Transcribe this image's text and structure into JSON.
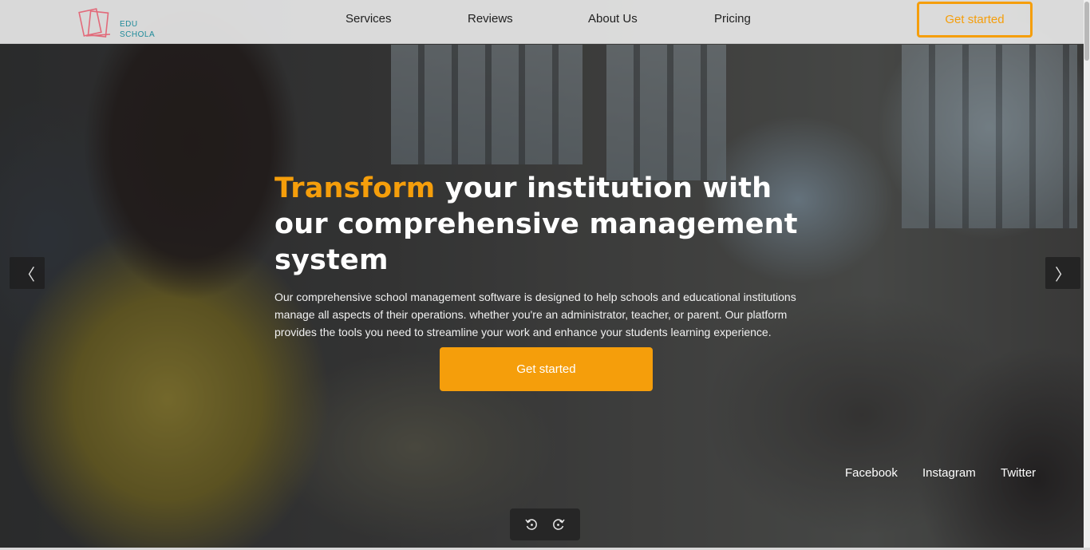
{
  "logo": {
    "line1": "EDU",
    "line2": "SCHOLA"
  },
  "nav": {
    "items": [
      {
        "label": "Services"
      },
      {
        "label": "Reviews"
      },
      {
        "label": "About Us"
      },
      {
        "label": "Pricing"
      }
    ],
    "cta_label": "Get started"
  },
  "hero": {
    "title_accent": "Transform",
    "title_rest": " your institution with our comprehensive management system",
    "description": "Our comprehensive school management software is designed to help schools and educational institutions manage all aspects of their operations. whether you're an administrator, teacher, or parent. Our platform provides the tools you need to streamline your work and enhance your students learning experience.",
    "cta_label": "Get started"
  },
  "carousel": {
    "prev_icon": "chevron-left-icon",
    "next_icon": "chevron-right-icon",
    "prev_glyph": "〈",
    "next_glyph": "〉"
  },
  "social": [
    {
      "label": "Facebook"
    },
    {
      "label": "Instagram"
    },
    {
      "label": "Twitter"
    }
  ],
  "controls": {
    "back_icon": "rewind-icon",
    "forward_icon": "forward-icon"
  },
  "colors": {
    "accent": "#f59e0b",
    "logo_teal": "#1e8a9a",
    "logo_red": "#e26a7a"
  }
}
